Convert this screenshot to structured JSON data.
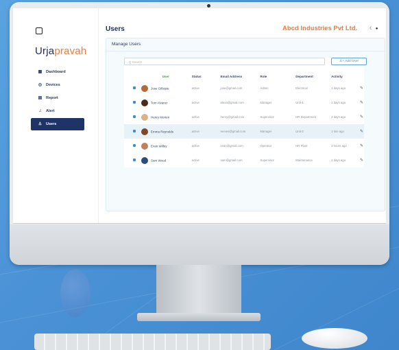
{
  "app": {
    "logo_main": "Urja",
    "logo_accent": "pravah",
    "page_title": "Users",
    "company": "Abcd Industries Pvt Ltd.",
    "panel_title": "Manage Users"
  },
  "sidebar": {
    "items": [
      {
        "label": "Dashboard",
        "icon": "grid-icon"
      },
      {
        "label": "Devices",
        "icon": "device-icon"
      },
      {
        "label": "Report",
        "icon": "report-icon"
      },
      {
        "label": "Alert",
        "icon": "bell-icon"
      },
      {
        "label": "Users",
        "icon": "users-icon"
      }
    ]
  },
  "toolbar": {
    "search_placeholder": "Q  Search",
    "add_user_label": "Add User"
  },
  "table": {
    "headers": [
      "User",
      "Status",
      "Email Address",
      "Role",
      "Department",
      "Activity"
    ],
    "rows": [
      {
        "name": "Jose Gillsipie",
        "status": "active",
        "email": "jose@gmail.com",
        "role": "Admin",
        "department": "Electrical",
        "activity": "1 days ago",
        "avatar": "#b06b3a"
      },
      {
        "name": "Tom Alvarez",
        "status": "active",
        "email": "alexa@gmail.com",
        "role": "Manager",
        "department": "Unit-1",
        "activity": "1 days ago",
        "avatar": "#4a2a1a"
      },
      {
        "name": "Henry Morten",
        "status": "active",
        "email": "henry@gmail.com",
        "role": "Supervisor",
        "department": "HR Department",
        "activity": "2 days ago",
        "avatar": "#d9b48a"
      },
      {
        "name": "Emma Reynolds",
        "status": "active",
        "email": "reeves@gmail.com",
        "role": "Manager",
        "department": "Unit-2",
        "activity": "1 min ago",
        "avatar": "#7a4a2a"
      },
      {
        "name": "Evan Willey",
        "status": "active",
        "email": "evan@gmail.com",
        "role": "Operator",
        "department": "HR Plant",
        "activity": "3 hours ago",
        "avatar": "#c08060"
      },
      {
        "name": "Sam Wood",
        "status": "active",
        "email": "sam@gmail.com",
        "role": "Supervisor",
        "department": "Maintenance",
        "activity": "1 days ago",
        "avatar": "#2a4d7a"
      }
    ]
  },
  "colors": {
    "accent": "#f07a3a",
    "brand": "#1e2d5c",
    "selected_row": "#e7f1f8"
  }
}
